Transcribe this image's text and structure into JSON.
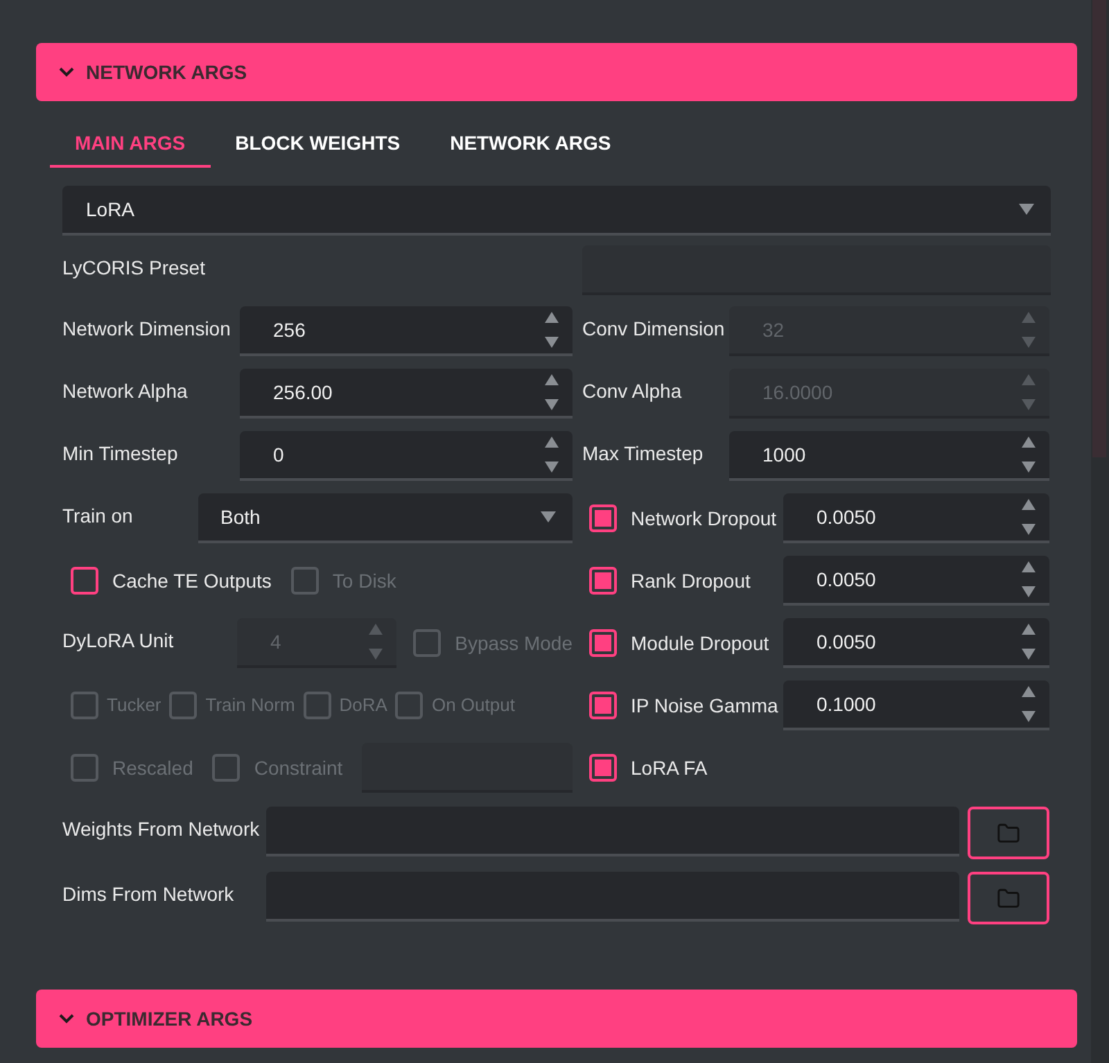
{
  "network_section": {
    "title": "NETWORK ARGS"
  },
  "tabs": [
    {
      "label": "MAIN ARGS",
      "selected": true
    },
    {
      "label": "BLOCK WEIGHTS",
      "selected": false
    },
    {
      "label": "NETWORK ARGS",
      "selected": false
    }
  ],
  "network_type": {
    "value": "LoRA"
  },
  "lycoris_preset": {
    "label": "LyCORIS Preset"
  },
  "left_rows": [
    {
      "kind": "number",
      "label": "Network Dimension",
      "value": "256",
      "disabled": false
    },
    {
      "kind": "number",
      "label": "Network Alpha",
      "value": "256.00",
      "disabled": false
    },
    {
      "kind": "number",
      "label": "Min Timestep",
      "value": "0",
      "disabled": false
    },
    {
      "kind": "select",
      "label": "Train on",
      "value": "Both"
    },
    {
      "kind": "checkboxes",
      "items": [
        {
          "label": "Cache TE Outputs",
          "checked": false,
          "disabled": false
        },
        {
          "label": "To Disk",
          "checked": false,
          "disabled": true
        }
      ]
    },
    {
      "kind": "dylora",
      "label": "DyLoRA Unit",
      "value": "4",
      "disabled": true,
      "items": [
        {
          "label": "Bypass Mode",
          "checked": false,
          "disabled": true
        }
      ]
    },
    {
      "kind": "checkboxes",
      "items": [
        {
          "label": "Tucker",
          "checked": false,
          "disabled": true
        },
        {
          "label": "Train Norm",
          "checked": false,
          "disabled": true
        },
        {
          "label": "DoRA",
          "checked": false,
          "disabled": true
        },
        {
          "label": "On Output",
          "checked": false,
          "disabled": true
        }
      ]
    },
    {
      "kind": "checkboxes_field",
      "items": [
        {
          "label": "Rescaled",
          "checked": false,
          "disabled": true
        },
        {
          "label": "Constraint",
          "checked": false,
          "disabled": true
        }
      ]
    }
  ],
  "right_rows": [
    {
      "kind": "number",
      "label": "Conv Dimension",
      "value": "32",
      "disabled": true
    },
    {
      "kind": "number",
      "label": "Conv Alpha",
      "value": "16.0000",
      "disabled": true
    },
    {
      "kind": "number",
      "label": "Max Timestep",
      "value": "1000",
      "disabled": false
    },
    {
      "kind": "check_number",
      "label": "Network Dropout",
      "checked": true,
      "value": "0.0050"
    },
    {
      "kind": "check_number",
      "label": "Rank Dropout",
      "checked": true,
      "value": "0.0050"
    },
    {
      "kind": "check_number",
      "label": "Module Dropout",
      "checked": true,
      "value": "0.0050"
    },
    {
      "kind": "check_number",
      "label": "IP Noise Gamma",
      "checked": true,
      "value": "0.1000"
    },
    {
      "kind": "check",
      "label": "LoRA FA",
      "checked": true
    }
  ],
  "path_rows": [
    {
      "label": "Weights From Network"
    },
    {
      "label": "Dims From Network"
    }
  ],
  "optimizer_section": {
    "title": "OPTIMIZER ARGS"
  }
}
